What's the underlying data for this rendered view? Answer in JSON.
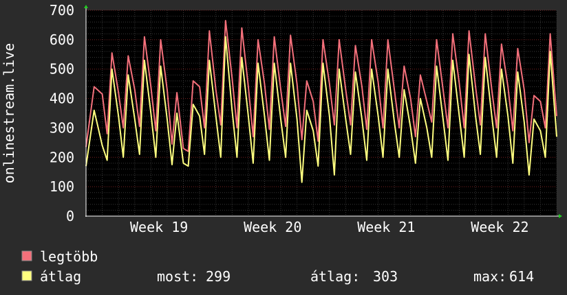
{
  "chart_data": {
    "type": "line",
    "ylabel": "onlinestream.live",
    "ylim": [
      0,
      700
    ],
    "yticks": [
      0,
      100,
      200,
      300,
      400,
      500,
      600,
      700
    ],
    "xlim": [
      0,
      29
    ],
    "week_ticks": [
      {
        "label": "Week 19",
        "x": 4.5
      },
      {
        "label": "Week 20",
        "x": 11.5
      },
      {
        "label": "Week 21",
        "x": 18.5
      },
      {
        "label": "Week 22",
        "x": 25.5
      }
    ],
    "grid": true,
    "legend_placement": "bottom-left",
    "series": [
      {
        "name": "legtöbb",
        "color": "#f4707b",
        "values": [
          [
            0,
            235
          ],
          [
            0.5,
            440
          ],
          [
            1,
            415
          ],
          [
            1.3,
            280
          ],
          [
            1.6,
            555
          ],
          [
            2,
            420
          ],
          [
            2.3,
            300
          ],
          [
            2.6,
            545
          ],
          [
            3,
            430
          ],
          [
            3.3,
            305
          ],
          [
            3.6,
            610
          ],
          [
            4,
            440
          ],
          [
            4.3,
            290
          ],
          [
            4.6,
            600
          ],
          [
            5,
            430
          ],
          [
            5.3,
            245
          ],
          [
            5.6,
            420
          ],
          [
            6,
            230
          ],
          [
            6.3,
            220
          ],
          [
            6.6,
            460
          ],
          [
            7,
            440
          ],
          [
            7.3,
            300
          ],
          [
            7.6,
            630
          ],
          [
            8,
            430
          ],
          [
            8.3,
            310
          ],
          [
            8.6,
            665
          ],
          [
            9,
            470
          ],
          [
            9.3,
            300
          ],
          [
            9.6,
            640
          ],
          [
            10,
            440
          ],
          [
            10.3,
            270
          ],
          [
            10.6,
            600
          ],
          [
            11,
            450
          ],
          [
            11.3,
            295
          ],
          [
            11.6,
            610
          ],
          [
            12,
            430
          ],
          [
            12.3,
            305
          ],
          [
            12.6,
            615
          ],
          [
            13,
            450
          ],
          [
            13.3,
            260
          ],
          [
            13.6,
            460
          ],
          [
            14,
            390
          ],
          [
            14.3,
            255
          ],
          [
            14.6,
            600
          ],
          [
            15,
            450
          ],
          [
            15.3,
            310
          ],
          [
            15.6,
            600
          ],
          [
            16,
            430
          ],
          [
            16.3,
            310
          ],
          [
            16.6,
            580
          ],
          [
            17,
            440
          ],
          [
            17.3,
            295
          ],
          [
            17.6,
            600
          ],
          [
            18,
            455
          ],
          [
            18.3,
            300
          ],
          [
            18.6,
            600
          ],
          [
            19,
            430
          ],
          [
            19.3,
            300
          ],
          [
            19.6,
            510
          ],
          [
            20,
            400
          ],
          [
            20.3,
            270
          ],
          [
            20.6,
            480
          ],
          [
            21,
            390
          ],
          [
            21.3,
            320
          ],
          [
            21.6,
            600
          ],
          [
            22,
            430
          ],
          [
            22.3,
            300
          ],
          [
            22.6,
            620
          ],
          [
            23,
            450
          ],
          [
            23.3,
            300
          ],
          [
            23.6,
            630
          ],
          [
            24,
            440
          ],
          [
            24.3,
            310
          ],
          [
            24.6,
            620
          ],
          [
            25,
            430
          ],
          [
            25.3,
            300
          ],
          [
            25.6,
            585
          ],
          [
            26,
            440
          ],
          [
            26.3,
            290
          ],
          [
            26.6,
            570
          ],
          [
            27,
            430
          ],
          [
            27.3,
            250
          ],
          [
            27.6,
            410
          ],
          [
            28,
            390
          ],
          [
            28.3,
            300
          ],
          [
            28.6,
            620
          ],
          [
            29,
            340
          ]
        ]
      },
      {
        "name": "átlag",
        "color": "#ffff80",
        "values": [
          [
            0,
            170
          ],
          [
            0.5,
            360
          ],
          [
            1,
            240
          ],
          [
            1.3,
            190
          ],
          [
            1.6,
            500
          ],
          [
            2,
            340
          ],
          [
            2.3,
            200
          ],
          [
            2.6,
            480
          ],
          [
            3,
            330
          ],
          [
            3.3,
            210
          ],
          [
            3.6,
            530
          ],
          [
            4,
            350
          ],
          [
            4.3,
            200
          ],
          [
            4.6,
            510
          ],
          [
            5,
            330
          ],
          [
            5.3,
            175
          ],
          [
            5.6,
            350
          ],
          [
            6,
            180
          ],
          [
            6.3,
            170
          ],
          [
            6.6,
            380
          ],
          [
            7,
            340
          ],
          [
            7.3,
            210
          ],
          [
            7.6,
            530
          ],
          [
            8,
            340
          ],
          [
            8.3,
            200
          ],
          [
            8.6,
            610
          ],
          [
            9,
            360
          ],
          [
            9.3,
            200
          ],
          [
            9.6,
            540
          ],
          [
            10,
            340
          ],
          [
            10.3,
            180
          ],
          [
            10.6,
            520
          ],
          [
            11,
            340
          ],
          [
            11.3,
            190
          ],
          [
            11.6,
            520
          ],
          [
            12,
            330
          ],
          [
            12.3,
            200
          ],
          [
            12.6,
            520
          ],
          [
            13,
            330
          ],
          [
            13.3,
            115
          ],
          [
            13.6,
            360
          ],
          [
            14,
            290
          ],
          [
            14.3,
            170
          ],
          [
            14.6,
            520
          ],
          [
            15,
            340
          ],
          [
            15.3,
            140
          ],
          [
            15.6,
            500
          ],
          [
            16,
            330
          ],
          [
            16.3,
            210
          ],
          [
            16.6,
            490
          ],
          [
            17,
            330
          ],
          [
            17.3,
            190
          ],
          [
            17.6,
            500
          ],
          [
            18,
            340
          ],
          [
            18.3,
            200
          ],
          [
            18.6,
            500
          ],
          [
            19,
            320
          ],
          [
            19.3,
            200
          ],
          [
            19.6,
            430
          ],
          [
            20,
            300
          ],
          [
            20.3,
            180
          ],
          [
            20.6,
            400
          ],
          [
            21,
            300
          ],
          [
            21.3,
            200
          ],
          [
            21.6,
            510
          ],
          [
            22,
            330
          ],
          [
            22.3,
            190
          ],
          [
            22.6,
            530
          ],
          [
            23,
            340
          ],
          [
            23.3,
            200
          ],
          [
            23.6,
            550
          ],
          [
            24,
            340
          ],
          [
            24.3,
            210
          ],
          [
            24.6,
            540
          ],
          [
            25,
            340
          ],
          [
            25.3,
            200
          ],
          [
            25.6,
            500
          ],
          [
            26,
            340
          ],
          [
            26.3,
            180
          ],
          [
            26.6,
            490
          ],
          [
            27,
            320
          ],
          [
            27.3,
            140
          ],
          [
            27.6,
            330
          ],
          [
            28,
            290
          ],
          [
            28.3,
            200
          ],
          [
            28.6,
            560
          ],
          [
            29,
            270
          ]
        ]
      }
    ],
    "stats": {
      "now_label": "most:",
      "now_value": "299",
      "avg_label": "átlag:",
      "avg_value": "303",
      "max_label": "max:",
      "max_value": "614"
    }
  }
}
